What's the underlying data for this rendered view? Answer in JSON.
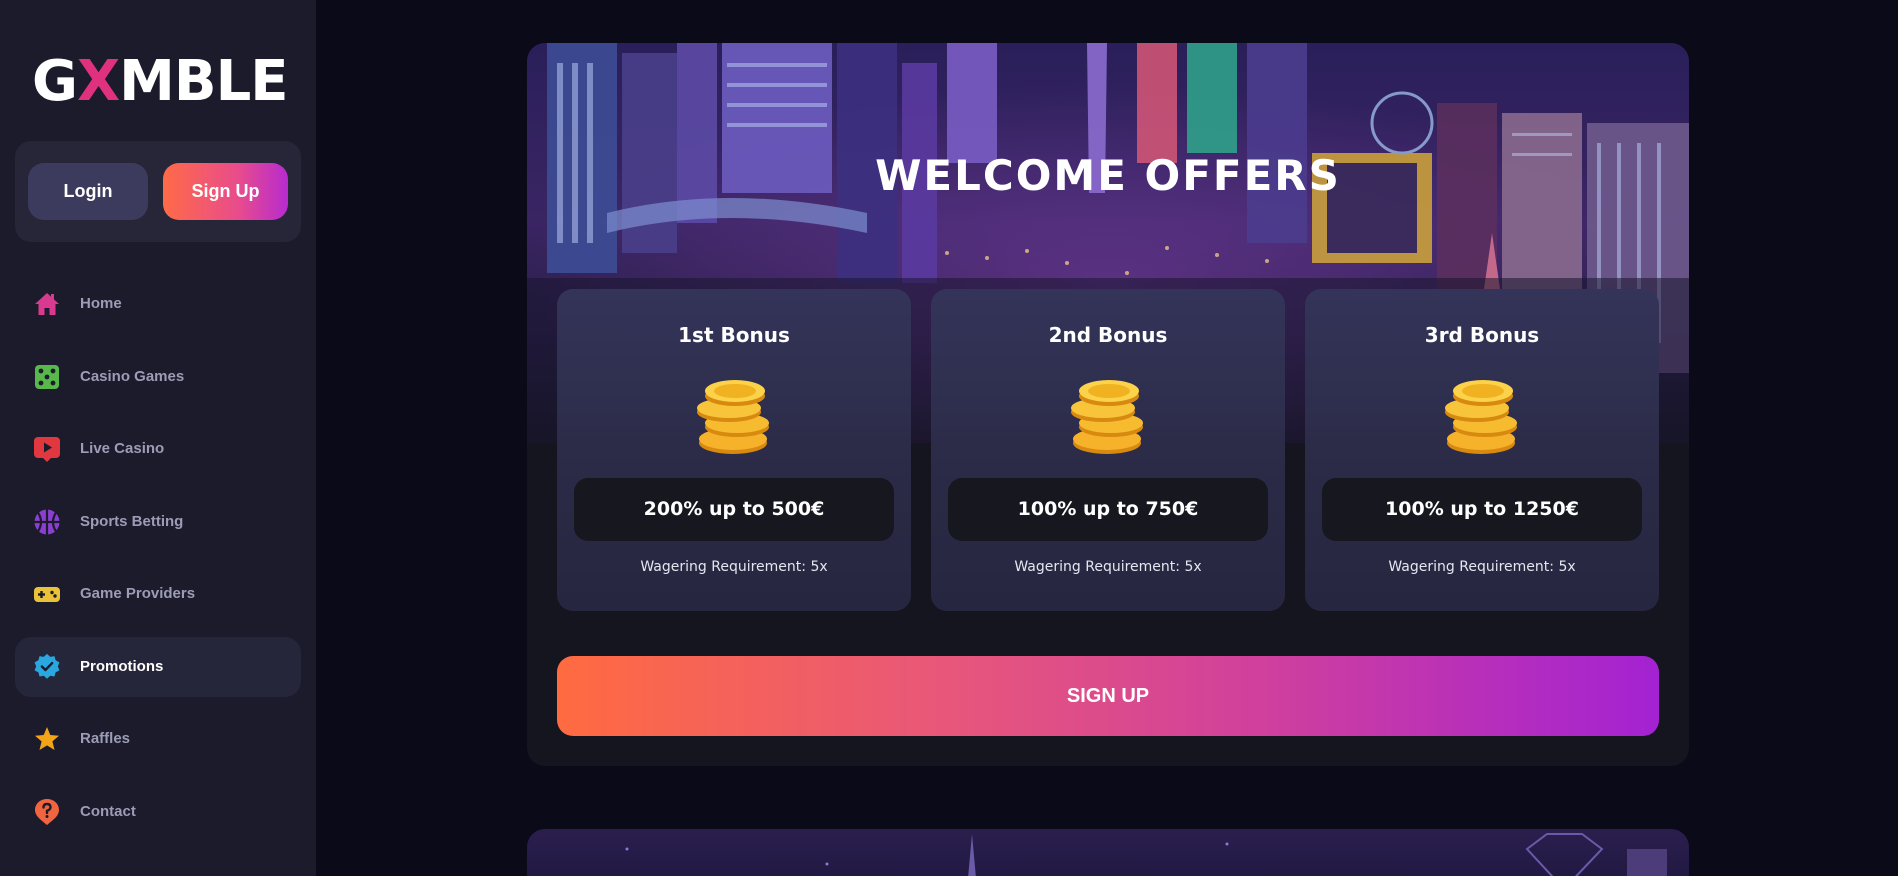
{
  "brand": {
    "logo_left": "G",
    "logo_x": "X",
    "logo_right": "MBLE",
    "accent": "#e0317f"
  },
  "auth": {
    "login_label": "Login",
    "signup_label": "Sign Up"
  },
  "nav": {
    "items": [
      {
        "label": "Home",
        "icon": "house-icon",
        "color": "#d83a8f"
      },
      {
        "label": "Casino Games",
        "icon": "dice-icon",
        "color": "#58b84b"
      },
      {
        "label": "Live Casino",
        "icon": "play-video-icon",
        "color": "#e0383e"
      },
      {
        "label": "Sports Betting",
        "icon": "basketball-icon",
        "color": "#8a3fd1"
      },
      {
        "label": "Game Providers",
        "icon": "gamepad-icon",
        "color": "#e9c23a"
      },
      {
        "label": "Promotions",
        "icon": "verified-badge-icon",
        "color": "#29a7e0",
        "active": true
      },
      {
        "label": "Raffles",
        "icon": "star-icon",
        "color": "#f2a516"
      },
      {
        "label": "Contact",
        "icon": "help-bubble-icon",
        "color": "#f0653f"
      }
    ]
  },
  "welcome": {
    "title": "WELCOME OFFERS",
    "bonuses": [
      {
        "title": "1st Bonus",
        "amount": "200% up to 500€",
        "wager": "Wagering Requirement: 5x"
      },
      {
        "title": "2nd Bonus",
        "amount": "100% up to 750€",
        "wager": "Wagering Requirement: 5x"
      },
      {
        "title": "3rd Bonus",
        "amount": "100% up to 1250€",
        "wager": "Wagering Requirement: 5x"
      }
    ],
    "signup_label": "SIGN UP"
  },
  "colors": {
    "background": "#0a0a19",
    "sidebar": "#1b1b2b",
    "card": "#15151f",
    "gradient_start": "#ff6b40",
    "gradient_end": "#a322d2"
  }
}
